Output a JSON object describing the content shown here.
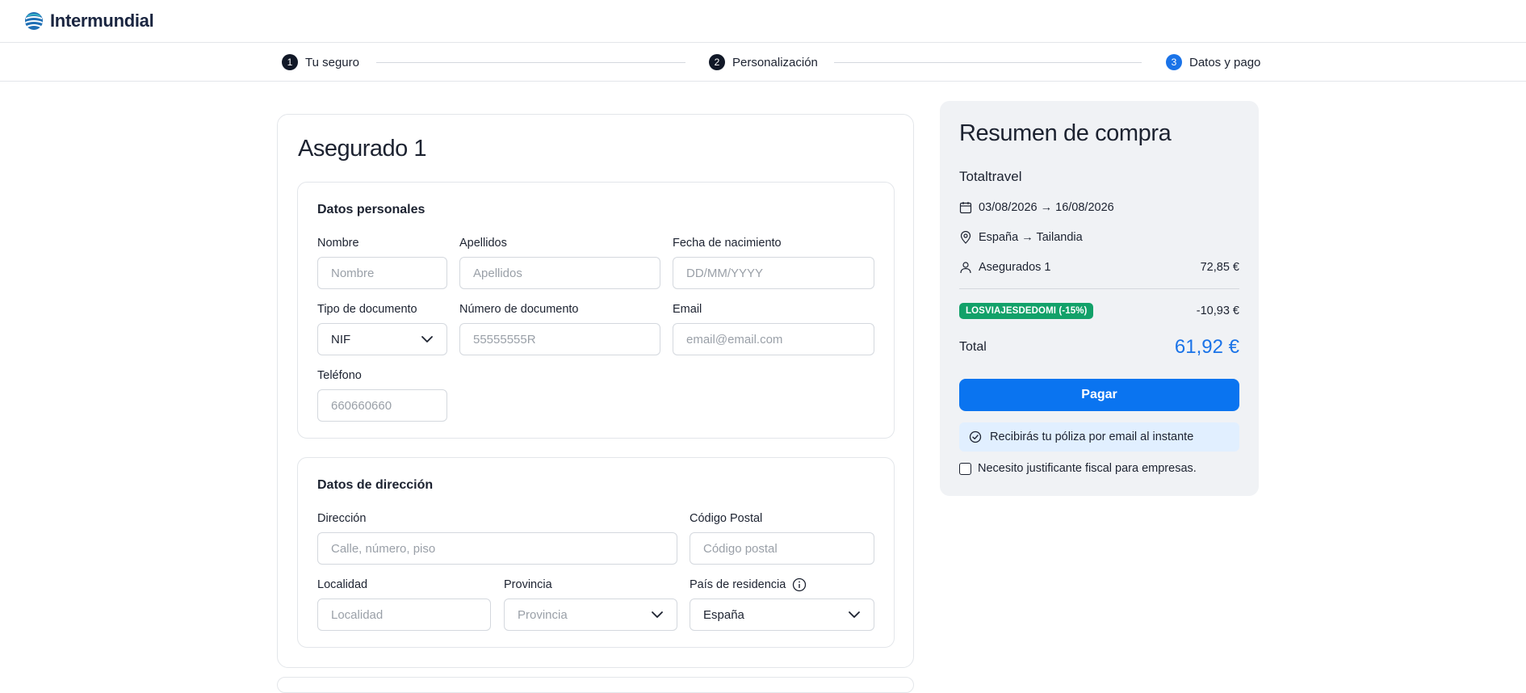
{
  "header": {
    "brand": "Intermundial",
    "logo_icon": "intermundial-logo-icon"
  },
  "stepper": {
    "steps": [
      {
        "number": "1",
        "label": "Tu seguro"
      },
      {
        "number": "2",
        "label": "Personalización"
      },
      {
        "number": "3",
        "label": "Datos y pago"
      }
    ],
    "active_step": 3,
    "active_color": "#1a73e8"
  },
  "insured": {
    "title": "Asegurado 1",
    "personal": {
      "title": "Datos personales",
      "nombre": {
        "label": "Nombre",
        "placeholder": "Nombre",
        "value": ""
      },
      "apellidos": {
        "label": "Apellidos",
        "placeholder": "Apellidos",
        "value": ""
      },
      "fecha": {
        "label": "Fecha de nacimiento",
        "placeholder": "DD/MM/YYYY",
        "value": ""
      },
      "tipo_doc": {
        "label": "Tipo de documento",
        "value": "NIF"
      },
      "num_doc": {
        "label": "Número de documento",
        "placeholder": "55555555R",
        "value": ""
      },
      "email": {
        "label": "Email",
        "placeholder": "email@email.com",
        "value": ""
      },
      "telefono": {
        "label": "Teléfono",
        "placeholder": "660660660",
        "value": ""
      }
    },
    "address": {
      "title": "Datos de dirección",
      "direccion": {
        "label": "Dirección",
        "placeholder": "Calle, número, piso",
        "value": ""
      },
      "cp": {
        "label": "Código Postal",
        "placeholder": "Código postal",
        "value": ""
      },
      "localidad": {
        "label": "Localidad",
        "placeholder": "Localidad",
        "value": ""
      },
      "provincia": {
        "label": "Provincia",
        "placeholder": "Provincia"
      },
      "pais": {
        "label": "País de residencia",
        "value": "España"
      }
    }
  },
  "summary": {
    "title": "Resumen de compra",
    "product": "Totaltravel",
    "dates": "03/08/2026 → 16/08/2026",
    "route": "España → Tailandia",
    "insured_label": "Asegurados 1",
    "insured_price": "72,85 €",
    "promo_code": "LOSVIAJESDEDOMI (-15%)",
    "promo_discount": "-10,93 €",
    "promo_color": "#12a169",
    "total_label": "Total",
    "total_value": "61,92 €",
    "pay_label": "Pagar",
    "pay_color": "#0a74f0",
    "notice": "Recibirás tu póliza por email al instante",
    "invoice_label": "Necesito justificante fiscal para empresas.",
    "invoice_checked": false
  }
}
